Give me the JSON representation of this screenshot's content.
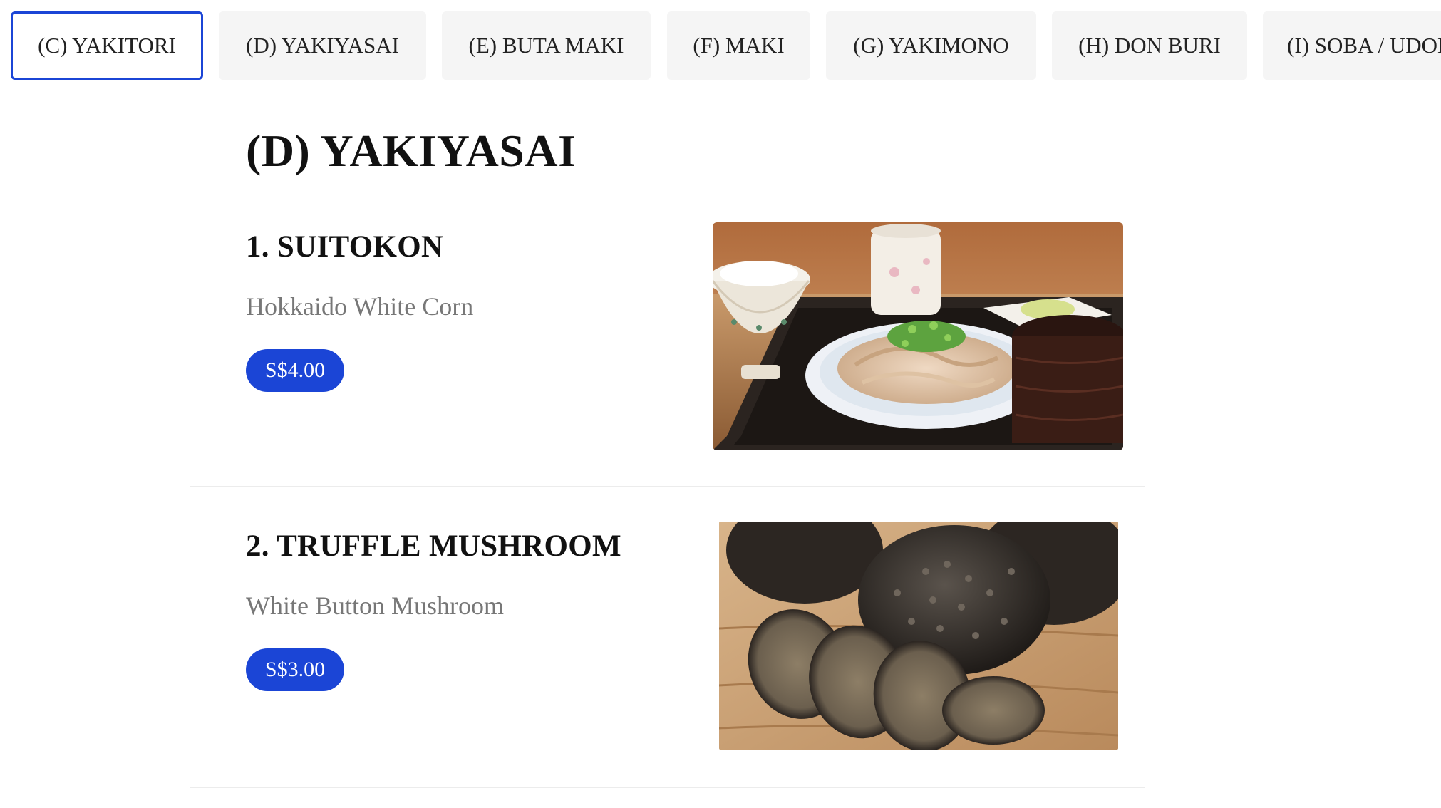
{
  "tabs": [
    {
      "label": "(C) YAKITORI",
      "active": true
    },
    {
      "label": "(D) YAKIYASAI",
      "active": false
    },
    {
      "label": "(E) BUTA MAKI",
      "active": false
    },
    {
      "label": "(F) MAKI",
      "active": false
    },
    {
      "label": "(G) YAKIMONO",
      "active": false
    },
    {
      "label": "(H) DON BURI",
      "active": false
    },
    {
      "label": "(I) SOBA / UDON",
      "active": false
    }
  ],
  "section": {
    "title": "(D) YAKIYASAI"
  },
  "items": [
    {
      "name": "1. SUITOKON",
      "description": "Hokkaido White Corn",
      "price": "S$4.00",
      "image_icon": "pork-set-meal-photo"
    },
    {
      "name": "2. TRUFFLE MUSHROOM",
      "description": "White Button Mushroom",
      "price": "S$3.00",
      "image_icon": "truffle-photo"
    }
  ],
  "colors": {
    "accent": "#1b45d6",
    "tab_bg": "#f5f5f5",
    "desc_text": "#777777",
    "divider": "#ececec"
  }
}
